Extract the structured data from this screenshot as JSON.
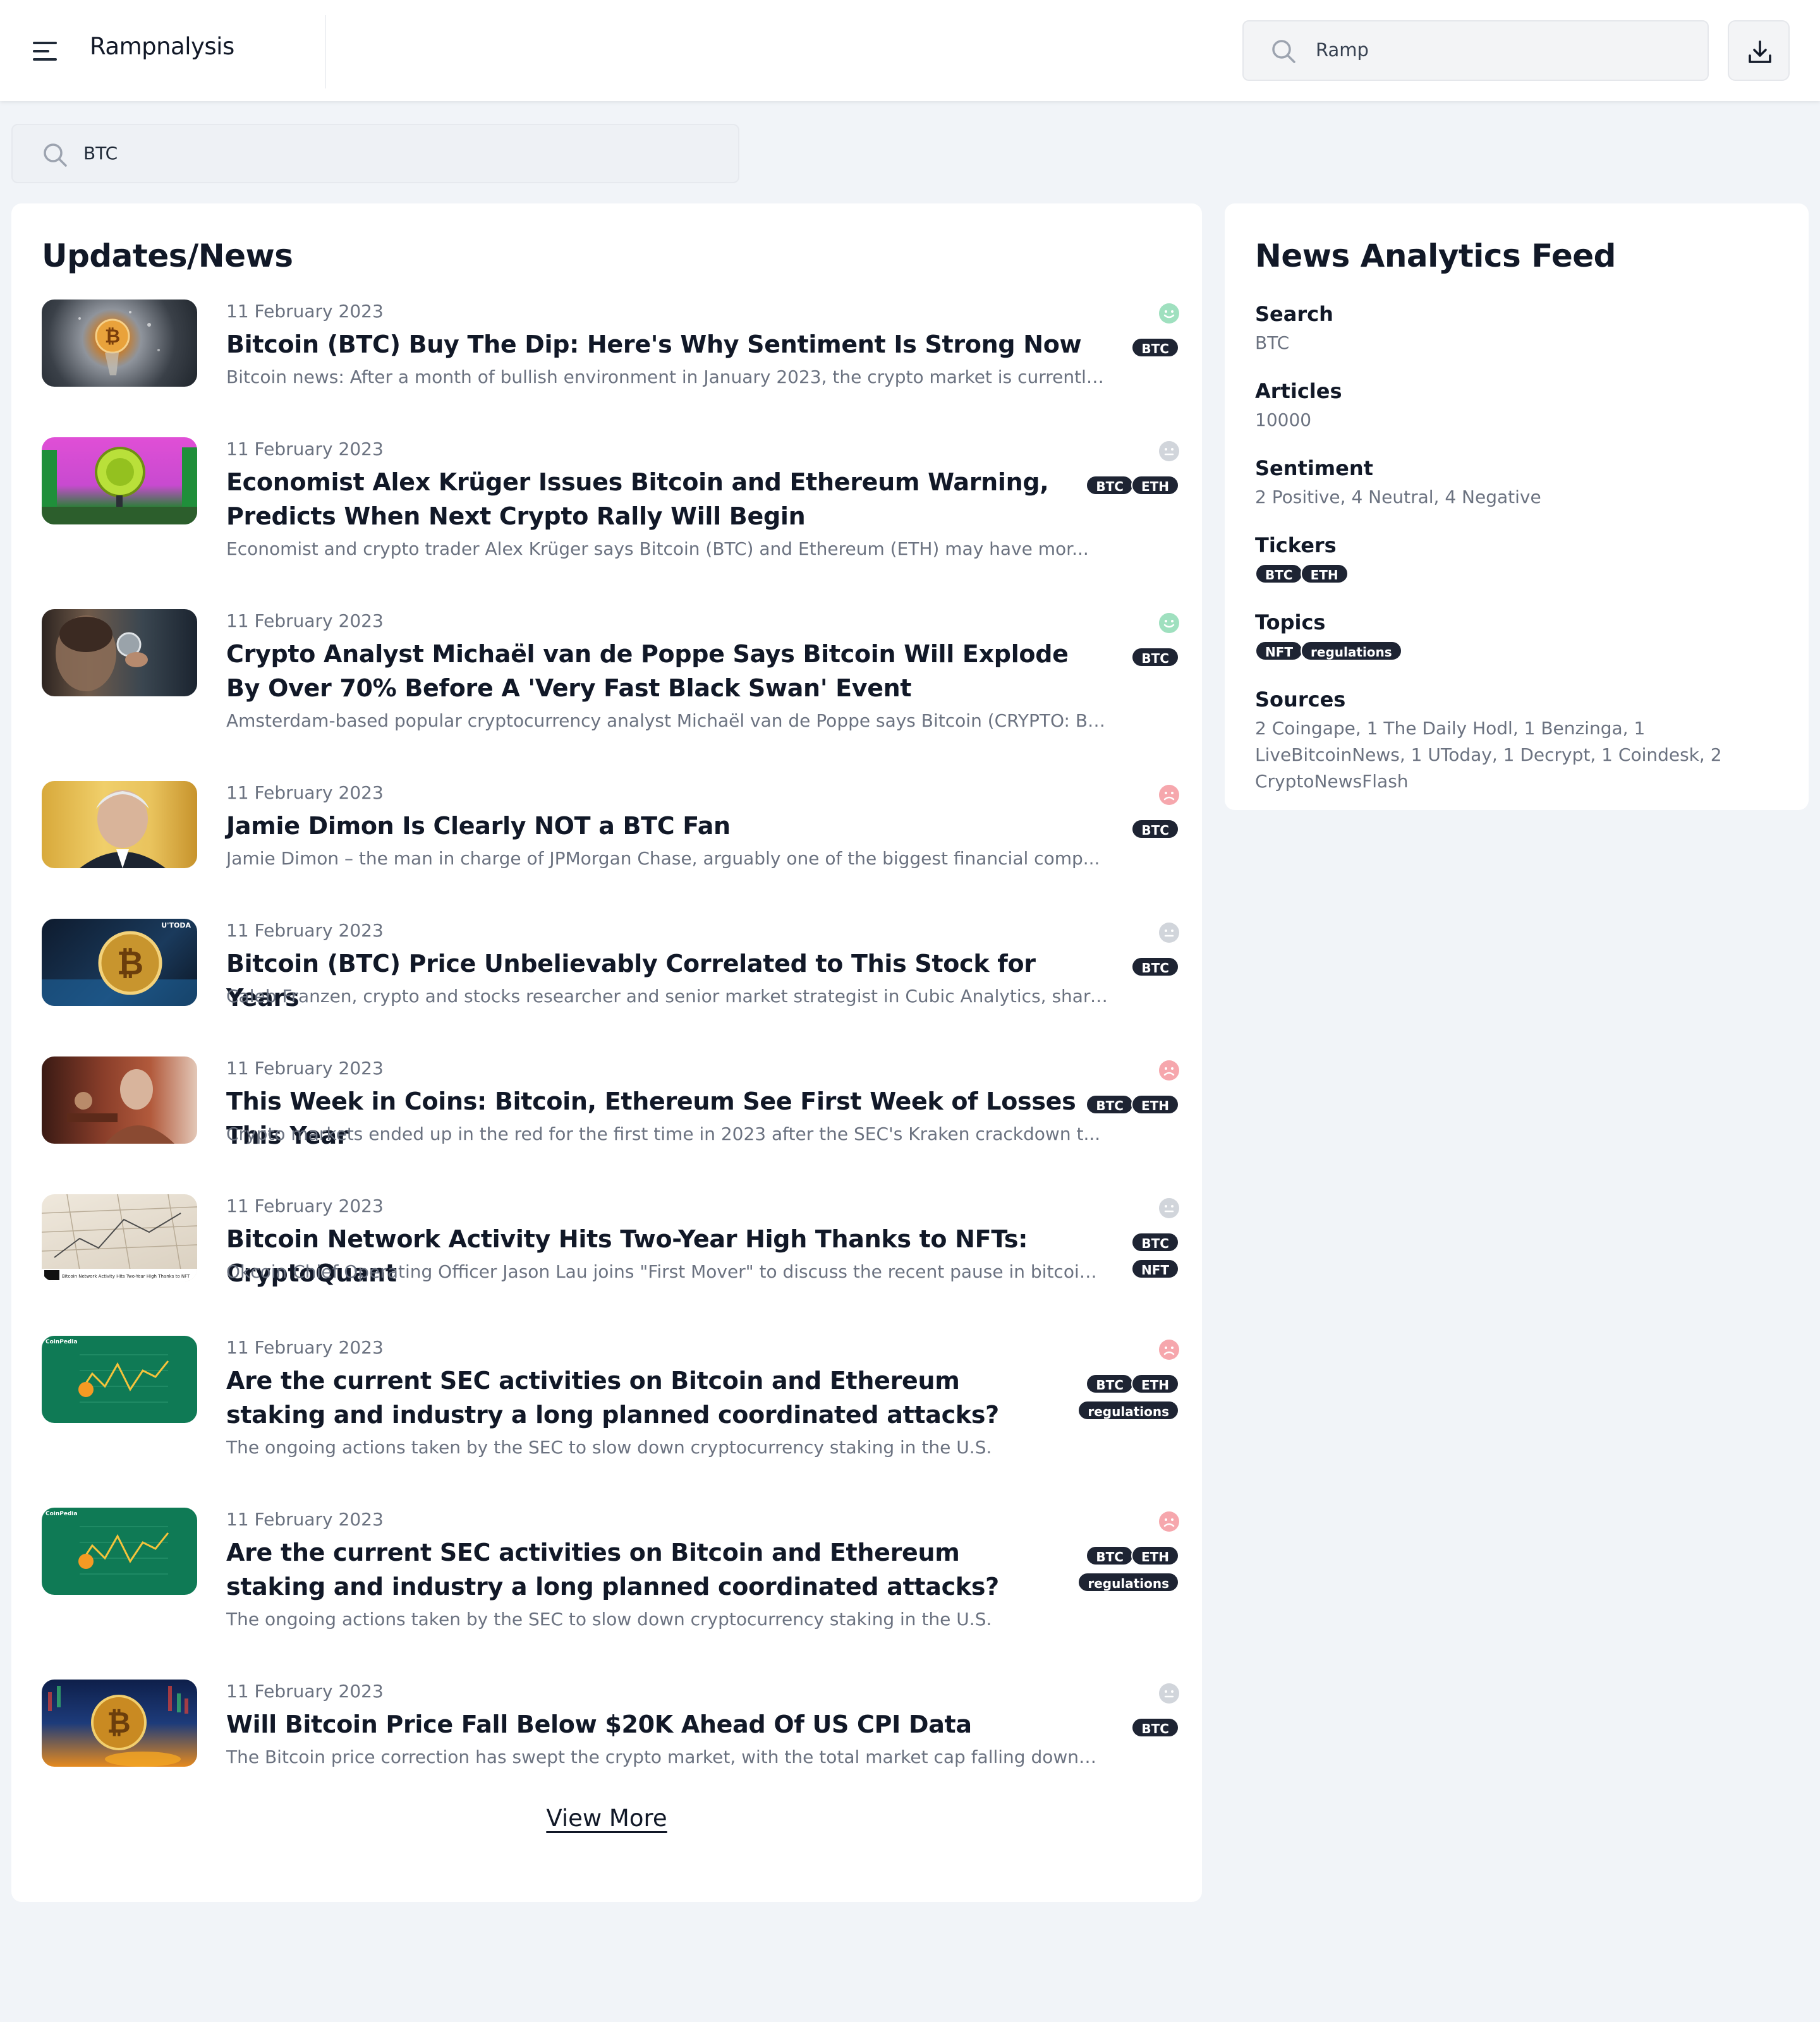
{
  "app": {
    "brand": "Rampnalysis",
    "top_search_value": "Ramp"
  },
  "search": {
    "value": "BTC"
  },
  "news": {
    "title": "Updates/News",
    "view_more": "View More",
    "items": [
      {
        "date": "11 February 2023",
        "headline": "Bitcoin (BTC) Buy The Dip: Here's Why Sentiment Is Strong Now",
        "summary": "Bitcoin news: After a month of bullish environment in January 2023, the crypto market is currently fa...",
        "sentiment": "positive",
        "tickers": [
          "BTC"
        ],
        "topics": []
      },
      {
        "date": "11 February 2023",
        "headline": "Economist Alex Krüger Issues Bitcoin and Ethereum Warning, Predicts When Next Crypto Rally Will Begin",
        "summary": "Economist and crypto trader Alex Krüger says Bitcoin (BTC) and Ethereum (ETH) may have mor...",
        "sentiment": "neutral",
        "tickers": [
          "BTC",
          "ETH"
        ],
        "topics": []
      },
      {
        "date": "11 February 2023",
        "headline": "Crypto Analyst Michaël van de Poppe Says Bitcoin Will Explode By Over 70% Before A 'Very Fast Black Swan' Event",
        "summary": "Amsterdam-based popular cryptocurrency analyst  Michaël van de Poppe says Bitcoin (CRYPTO: BT...",
        "sentiment": "positive",
        "tickers": [
          "BTC"
        ],
        "topics": []
      },
      {
        "date": "11 February 2023",
        "headline": "Jamie Dimon Is Clearly NOT a BTC Fan",
        "summary": "Jamie Dimon – the man in charge of JPMorgan Chase, arguably one of the biggest financial comp...",
        "sentiment": "negative",
        "tickers": [
          "BTC"
        ],
        "topics": []
      },
      {
        "date": "11 February 2023",
        "headline": "Bitcoin (BTC) Price Unbelievably Correlated to This Stock for Years",
        "summary": "Caleb Franzen, crypto and stocks researcher and senior market strategist in Cubic Analytics, shares...",
        "sentiment": "neutral",
        "tickers": [
          "BTC"
        ],
        "topics": [],
        "thumb_overlay": "U'TODA"
      },
      {
        "date": "11 February 2023",
        "headline": "This Week in Coins: Bitcoin, Ethereum See First Week of Losses This Year",
        "summary": "Crypto markets ended up in the red for the first time in 2023 after the SEC's Kraken crackdown t...",
        "sentiment": "negative",
        "tickers": [
          "BTC",
          "ETH"
        ],
        "topics": []
      },
      {
        "date": "11 February 2023",
        "headline": "Bitcoin Network Activity Hits Two-Year High Thanks to NFTs: CryptoQuant",
        "summary": "Okcoin Chief Operating Officer Jason Lau joins \"First Mover\" to discuss the recent pause in bitcoin's J...",
        "sentiment": "neutral",
        "tickers": [
          "BTC"
        ],
        "topics": [
          "NFT"
        ],
        "thumb_overlay": "Bitcoin Network Activity Hits Two-Year High Thanks to NFT"
      },
      {
        "date": "11 February 2023",
        "headline": "Are the current SEC activities on Bitcoin and Ethereum staking and industry a long planned coordinated attacks?",
        "summary": "The ongoing actions taken by the SEC to slow down cryptocurrency staking in the U.S.",
        "sentiment": "negative",
        "tickers": [
          "BTC",
          "ETH"
        ],
        "topics": [
          "regulations"
        ],
        "thumb_overlay": "CoinPedia"
      },
      {
        "date": "11 February 2023",
        "headline": "Are the current SEC activities on Bitcoin and Ethereum staking and industry a long planned coordinated attacks?",
        "summary": "The ongoing actions taken by the SEC to slow down cryptocurrency staking in the U.S.",
        "sentiment": "negative",
        "tickers": [
          "BTC",
          "ETH"
        ],
        "topics": [
          "regulations"
        ],
        "thumb_overlay": "CoinPedia"
      },
      {
        "date": "11 February 2023",
        "headline": "Will Bitcoin Price Fall Below $20K Ahead Of US CPI Data",
        "summary": "The Bitcoin price correction has swept the crypto market, with the total market cap falling down to ...",
        "sentiment": "neutral",
        "tickers": [
          "BTC"
        ],
        "topics": []
      }
    ]
  },
  "feed": {
    "title": "News Analytics Feed",
    "search_label": "Search",
    "search_value": "BTC",
    "articles_label": "Articles",
    "articles_value": "10000",
    "sentiment_label": "Sentiment",
    "sentiment_value": "2 Positive, 4 Neutral, 4 Negative",
    "tickers_label": "Tickers",
    "tickers": [
      "BTC",
      "ETH"
    ],
    "topics_label": "Topics",
    "topics": [
      "NFT",
      "regulations"
    ],
    "sources_label": "Sources",
    "sources_value": "2 Coingape, 1 The Daily Hodl, 1 Benzinga, 1 LiveBitcoinNews, 1 UToday, 1 Decrypt, 1 Coindesk, 2 CryptoNewsFlash"
  },
  "colors": {
    "background": "#f1f4f8",
    "card": "#ffffff",
    "tag": "#1e2433",
    "positive": "#9fe0bf",
    "neutral": "#d1d5db",
    "negative": "#f6a7ad"
  }
}
